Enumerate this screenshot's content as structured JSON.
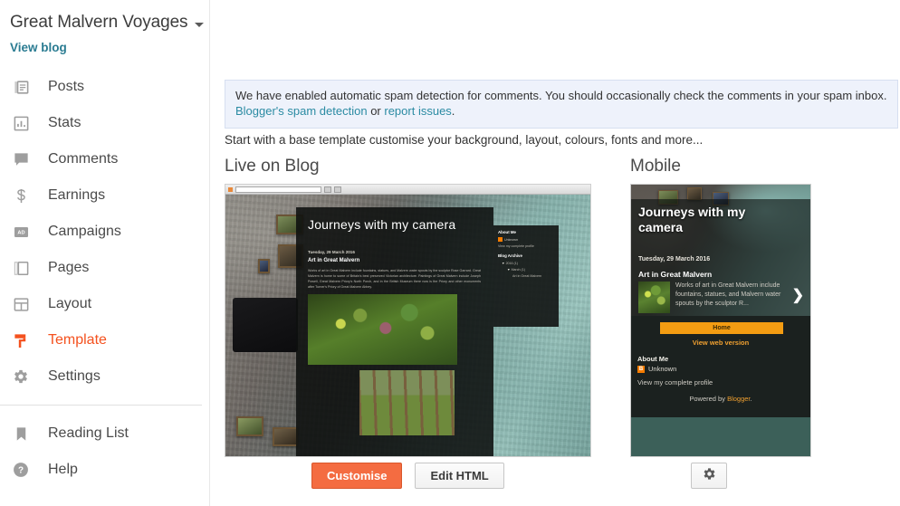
{
  "sidebar": {
    "blog_name": "Great Malvern Voyages",
    "view_blog_label": "View blog",
    "items": [
      {
        "label": "Posts",
        "icon": "posts-icon"
      },
      {
        "label": "Stats",
        "icon": "stats-icon"
      },
      {
        "label": "Comments",
        "icon": "comments-icon"
      },
      {
        "label": "Earnings",
        "icon": "earnings-icon"
      },
      {
        "label": "Campaigns",
        "icon": "campaigns-icon"
      },
      {
        "label": "Pages",
        "icon": "pages-icon"
      },
      {
        "label": "Layout",
        "icon": "layout-icon"
      },
      {
        "label": "Template",
        "icon": "template-icon"
      },
      {
        "label": "Settings",
        "icon": "settings-icon"
      }
    ],
    "footer_items": [
      {
        "label": "Reading List",
        "icon": "bookmark-icon"
      },
      {
        "label": "Help",
        "icon": "help-icon"
      }
    ],
    "active_item": "Template",
    "active_color": "#f4511e",
    "link_color": "#2b7c92"
  },
  "banner": {
    "text": "We have enabled automatic spam detection for comments. You should occasionally check the comments in your spam inbox.",
    "link_1": "Blogger's spam detection",
    "conjunction": " or ",
    "link_2": "report issues",
    "period": ".",
    "background": "#eef2fb",
    "link_color": "#2b8ba3"
  },
  "main": {
    "subtitle": "Start with a base template customise your background, layout, colours, fonts and more...",
    "heading_live": "Live on Blog",
    "heading_mobile": "Mobile"
  },
  "preview_desktop": {
    "browser_url_placeholder": "",
    "blog_heading": "Journeys with my camera",
    "post_date": "Tuesday, 29 March 2016",
    "post_title": "Art in Great Malvern",
    "post_body": "Works of art in Great Malvern include fountains, statues, and Malvern water spouts by the sculptor Rose Garrard. Great Malvern is home to some of Britain's best preserved Victorian architecture. Paintings of Great Malvern include Joseph Powell, Great Malvern Priory's North Porch, and in the British Museum there now is the Priory and other monuments after Turner's Priory of Great Malvern Abbey.",
    "sidebar_about_heading": "About Me",
    "sidebar_author": "Unknown",
    "sidebar_profile_link": "View my complete profile",
    "sidebar_archive_heading": "Blog Archive",
    "archive_tree": [
      {
        "level": 1,
        "label": "2016 (1)"
      },
      {
        "level": 2,
        "label": "March (1)"
      },
      {
        "level": 3,
        "label": "Art in Great Malvern"
      }
    ]
  },
  "preview_mobile": {
    "blog_heading": "Journeys with my camera",
    "post_date": "Tuesday, 29 March 2016",
    "post_title": "Art in Great Malvern",
    "post_excerpt": "Works of art in Great Malvern include fountains, statues, and Malvern water spouts by the sculptor R...",
    "next_chevron": "❯",
    "home_label": "Home",
    "web_version_label": "View web version",
    "about_heading": "About Me",
    "author_name": "Unknown",
    "author_badge": "B",
    "profile_link": "View my complete profile",
    "powered_by_prefix": "Powered by ",
    "powered_by_name": "Blogger",
    "powered_by_suffix": "."
  },
  "actions": {
    "customise_label": "Customise",
    "edit_html_label": "Edit HTML",
    "mobile_settings_icon": "gear-icon",
    "primary_color": "#f46c41"
  }
}
